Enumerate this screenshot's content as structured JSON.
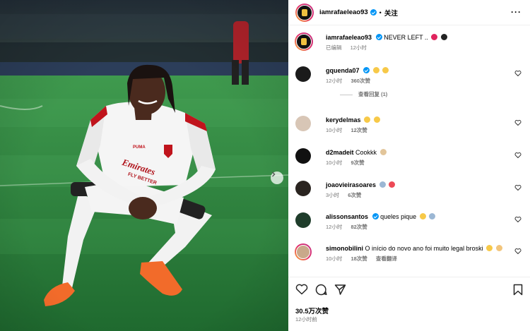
{
  "photo": {
    "sponsor_text": "Emirates",
    "sponsor_sub": "FLY BETTER",
    "brand": "PUMA",
    "next_icon": "chevron-right-icon"
  },
  "header": {
    "username": "iamrafaeleao93",
    "separator": "•",
    "follow_label": "关注",
    "more_label": "···"
  },
  "caption": {
    "username": "iamrafaeleao93",
    "text": "NEVER LEFT ..",
    "meta_edited": "已编辑",
    "meta_time": "12小时"
  },
  "comments": [
    {
      "username": "gquenda07",
      "verified": true,
      "text": "",
      "emojis": [
        "heart-eyes",
        "heart-eyes"
      ],
      "time": "12小时",
      "likes": "360次赞",
      "view_replies": "查看回复 (1)"
    },
    {
      "username": "kerydelmas",
      "verified": false,
      "text": "",
      "emojis": [
        "heart-eyes",
        "heart-eyes"
      ],
      "time": "10小时",
      "likes": "12次赞"
    },
    {
      "username": "d2madeit",
      "verified": false,
      "text": "Cookkk",
      "emojis": [
        "goat"
      ],
      "time": "10小时",
      "likes": "9次赞"
    },
    {
      "username": "joaovieirasoares",
      "verified": false,
      "text": "",
      "emojis": [
        "goat",
        "heart"
      ],
      "time": "3小时",
      "likes": "6次赞"
    },
    {
      "username": "alissonsantos",
      "verified": true,
      "text": "queles pique",
      "emojis": [
        "heart-eyes",
        "goat"
      ],
      "time": "12小时",
      "likes": "82次赞"
    },
    {
      "username": "simonobilini",
      "verified": false,
      "text": "O início do novo ano foi muito legal broski",
      "emojis": [
        "tongue-face",
        "clap"
      ],
      "time": "10小时",
      "likes": "18次赞",
      "translate": "查看翻译"
    }
  ],
  "footer": {
    "likes": "30.5万次赞",
    "posted": "12小时前"
  },
  "colors": {
    "verified": "#0095f6",
    "heart": "#ed4956",
    "muted": "#737373",
    "pitch": "#2e7d3c"
  }
}
